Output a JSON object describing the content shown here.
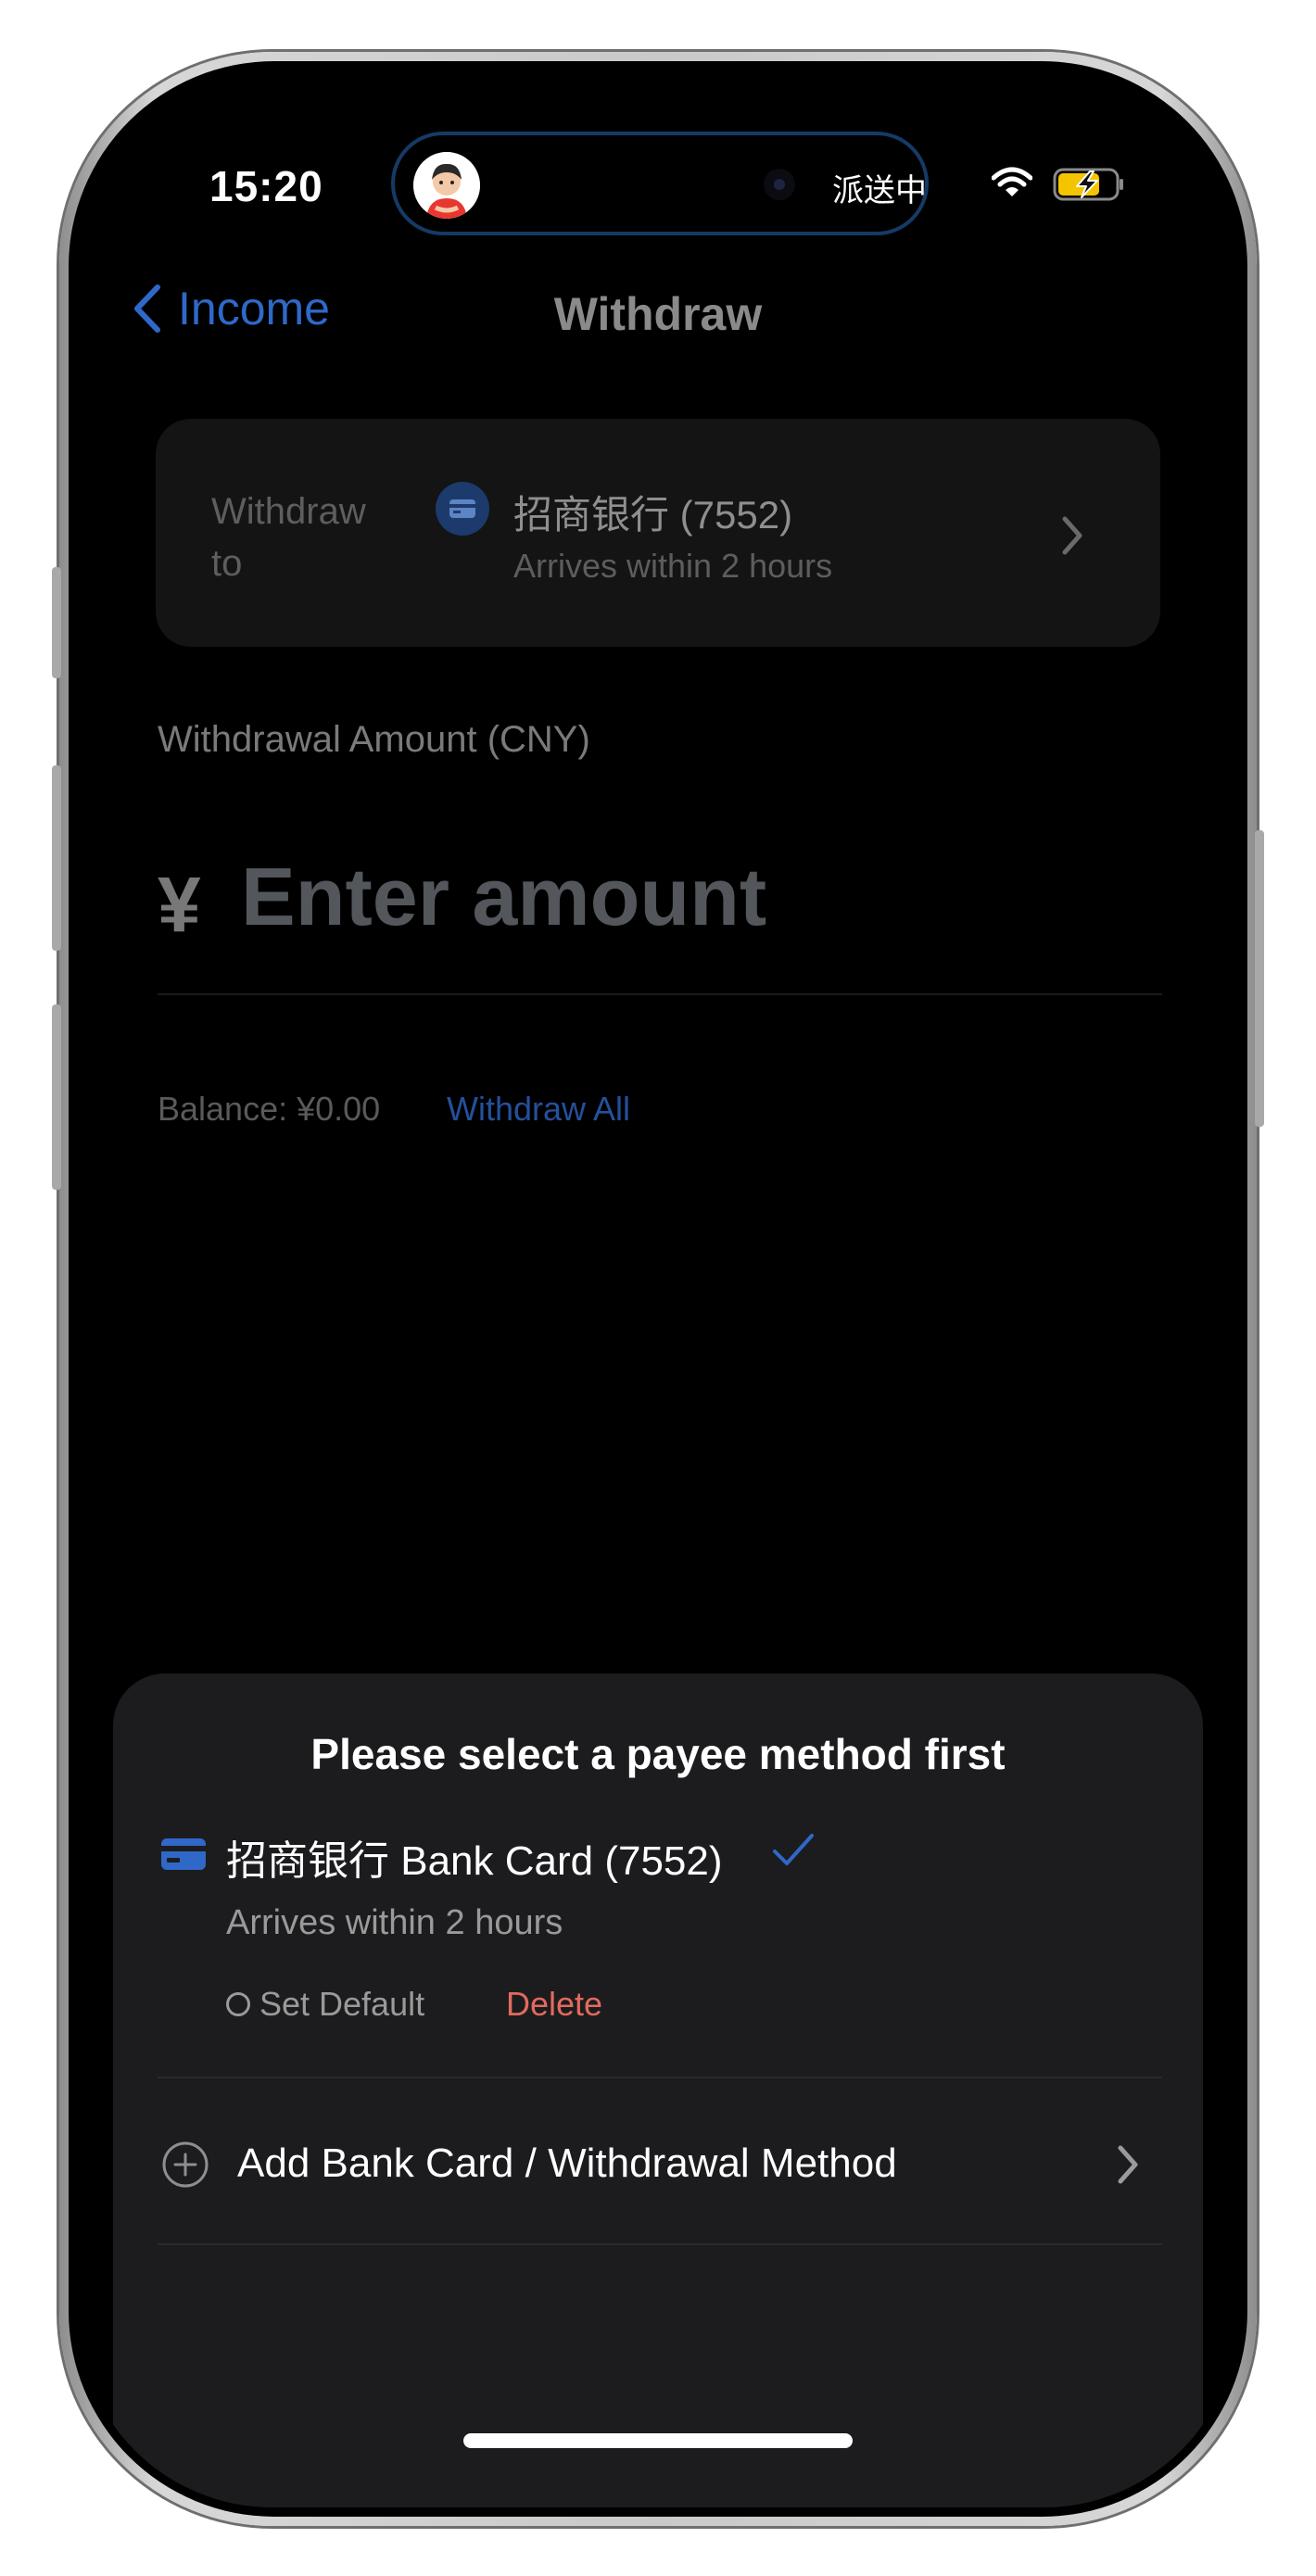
{
  "status_bar": {
    "time": "15:20",
    "live_activity": "派送中",
    "icons": [
      "wifi-icon",
      "battery-charging-icon"
    ],
    "battery_color": "#f5c400"
  },
  "nav": {
    "back_label": "Income",
    "title": "Withdraw"
  },
  "withdraw_to": {
    "label": "Withdraw to",
    "bank_name": "招商银行 (7552)",
    "arrival": "Arrives within 2 hours"
  },
  "amount": {
    "label": "Withdrawal Amount (CNY)",
    "currency_symbol": "¥",
    "placeholder": "Enter amount",
    "value": ""
  },
  "balance": {
    "text": "Balance: ¥0.00",
    "withdraw_all": "Withdraw All"
  },
  "sheet": {
    "title": "Please select a payee method first",
    "methods": [
      {
        "name": "招商银行 Bank Card (7552)",
        "arrival": "Arrives within 2 hours",
        "selected": true,
        "set_default": "Set Default",
        "delete": "Delete"
      }
    ],
    "add_method": "Add Bank Card / Withdrawal Method"
  },
  "colors": {
    "accent": "#2f68c8",
    "delete": "#e36a5e",
    "sheet_bg": "#1c1c1e"
  }
}
